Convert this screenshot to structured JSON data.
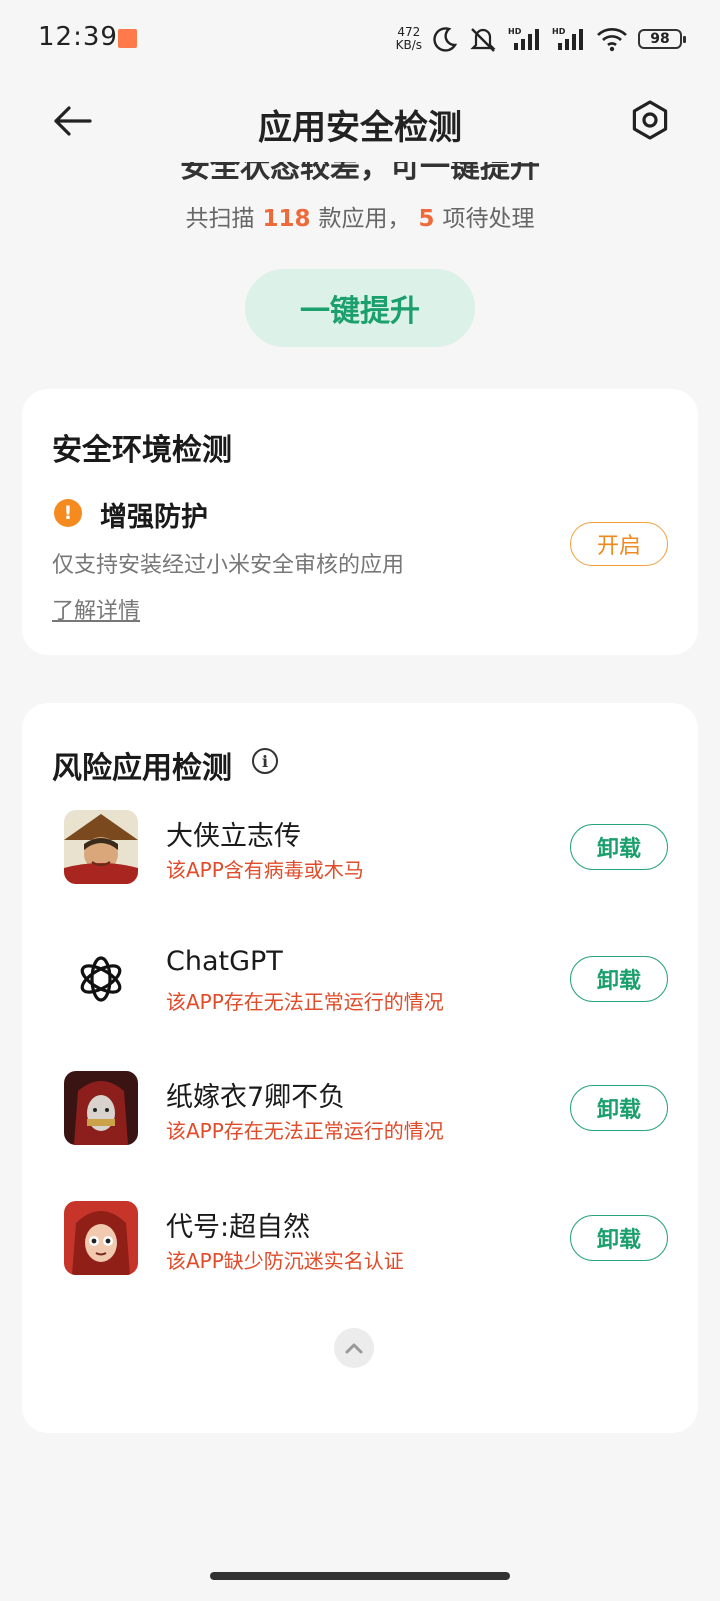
{
  "status_bar": {
    "time": "12:39",
    "net_speed_value": "472",
    "net_speed_unit": "KB/s",
    "battery": "98"
  },
  "header": {
    "title": "应用安全检测"
  },
  "summary": {
    "headline": "安全状态较差，可一键提升",
    "scan_prefix": "共扫描",
    "scan_count": "118",
    "scan_middle": "款应用，",
    "pending_count": "5",
    "scan_suffix": "项待处理"
  },
  "boost_button": "一键提升",
  "env_card": {
    "title": "安全环境检测",
    "item_title": "增强防护",
    "item_desc": "仅支持安装经过小米安全审核的应用",
    "learn_more": "了解详情",
    "button": "开启"
  },
  "risk_card": {
    "title": "风险应用检测",
    "apps": [
      {
        "name": "大侠立志传",
        "warning": "该APP含有病毒或木马",
        "button": "卸载"
      },
      {
        "name": "ChatGPT",
        "warning": "该APP存在无法正常运行的情况",
        "button": "卸载"
      },
      {
        "name": "纸嫁衣7卿不负",
        "warning": "该APP存在无法正常运行的情况",
        "button": "卸载"
      },
      {
        "name": "代号:超自然",
        "warning": "该APP缺少防沉迷实名认证",
        "button": "卸载"
      }
    ]
  },
  "colors": {
    "accent_green": "#1b9f6c",
    "warning_orange": "#f08a1e",
    "danger_red": "#e04b2a",
    "highlight_number": "#ef6a3a"
  }
}
